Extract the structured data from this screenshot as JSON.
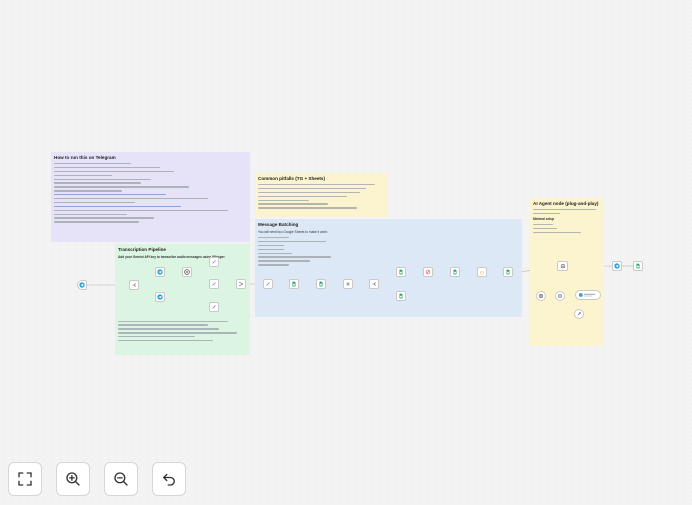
{
  "notes": {
    "telegram": {
      "title": "How to run this on Telegram"
    },
    "transcription": {
      "title": "Transcription Pipeline",
      "subtitle": "Add your Gemini API key to transcribe audio messages using Whisper"
    },
    "pitfalls": {
      "title": "Common pitfalls (TG + Sheets)"
    },
    "batching": {
      "title": "Message Batching",
      "subtitle": "You will need two Google Sheets to make it work:"
    },
    "agent": {
      "title": "AI Agent node (plug-and-play)",
      "subtitle": "Minimal setup"
    }
  },
  "colors": {
    "purple": "#e6e3f8",
    "green": "#dcf4e2",
    "yellow": "#fcf3cf",
    "blue": "#dde8f7"
  },
  "controls": {
    "fit": {
      "icon": "fit-view-icon"
    },
    "zoom_in": {
      "icon": "zoom-in-icon"
    },
    "zoom_out": {
      "icon": "zoom-out-icon"
    },
    "reset": {
      "icon": "undo-icon"
    }
  }
}
